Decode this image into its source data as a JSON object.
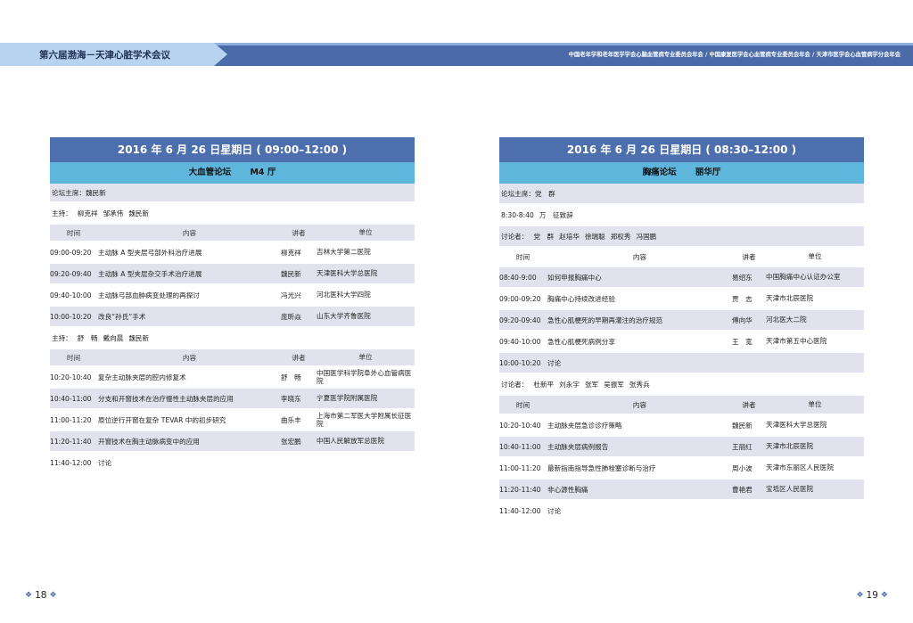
{
  "header": {
    "left_title": "第六届渤海－天津心脏学术会议",
    "right_title": "中国老年学和老年医学学会心脑血管病专业委员会年会 / 中国康复医学会心血管病专业委员会年会 / 天津市医学会心血管病学分会年会"
  },
  "columns": {
    "time": "时间",
    "content": "内容",
    "speaker": "讲者",
    "unit": "单位"
  },
  "left": {
    "date": "2016 年 6 月 26 日星期日 ( 09:00–12:00 )",
    "forum_name": "大血管论坛",
    "forum_room": "M4 厅",
    "chair": "论坛主席：魏民新",
    "host1_label": "主持：",
    "host1_names": [
      "柳克祥",
      "邹承伟",
      "魏民新"
    ],
    "rows1": [
      {
        "time": "09:00-09:20",
        "content": "主动脉 A 型夹层弓部外科治疗进展",
        "speaker": "柳克祥",
        "unit": "吉林大学第二医院"
      },
      {
        "time": "09:20-09:40",
        "content": "主动脉 A 型夹层杂交手术治疗进展",
        "speaker": "魏民新",
        "unit": "天津医科大学总医院"
      },
      {
        "time": "09:40-10:00",
        "content": "主动脉弓部血肿病变处理的再探讨",
        "speaker": "冯光兴",
        "unit": "河北医科大学四院"
      },
      {
        "time": "10:00-10:20",
        "content": "改良“孙氏”手术",
        "speaker": "庞昕焱",
        "unit": "山东大学齐鲁医院"
      }
    ],
    "host2_label": "主持：",
    "host2_names": [
      "舒　畅",
      "戴向晨",
      "魏民新"
    ],
    "rows2": [
      {
        "time": "10:20-10:40",
        "content": "复杂主动脉夹层的腔内修复术",
        "speaker": "舒　畅",
        "unit": "中国医学科学院阜外心血管病医院"
      },
      {
        "time": "10:40-11:00",
        "content": "分支和开窗技术在治疗慢性主动脉夹层的应用",
        "speaker": "李晓东",
        "unit": "宁夏医学院附属医院"
      },
      {
        "time": "11:00-11:20",
        "content": "原位逆行开窗在复杂 TEVAR 中的初步研究",
        "speaker": "曲乐丰",
        "unit": "上海市第二军医大学附属长征医院"
      },
      {
        "time": "11:20-11:40",
        "content": "开窗技术在胸主动脉病变中的应用",
        "speaker": "张宏鹏",
        "unit": "中国人民解放军总医院"
      }
    ],
    "end_time": "11:40-12:00",
    "end_label": "讨论"
  },
  "right": {
    "date": "2016 年 6 月 26 日星期日 ( 08:30–12:00 )",
    "forum_name": "胸痛论坛",
    "forum_room": "丽华厅",
    "chair": "论坛主席：党　群",
    "opening_time": "8:30-8:40",
    "opening_names": [
      "万　征致辞"
    ],
    "disc1_label": "讨论者：",
    "disc1_names": [
      "党　群",
      "赵培华",
      "徐瑞聪",
      "郑权秀",
      "冯国鹏"
    ],
    "rows1": [
      {
        "time": "08:40-9:00",
        "content": "如何申报胸痛中心",
        "speaker": "易绍东",
        "unit": "中国胸痛中心认证办公室"
      },
      {
        "time": "09:00-09:20",
        "content": "胸痛中心持续改进经验",
        "speaker": "贾　志",
        "unit": "天津市北辰医院"
      },
      {
        "time": "09:20-09:40",
        "content": "急性心肌梗死的早期再灌注的治疗规范",
        "speaker": "傅向华",
        "unit": "河北医大二院"
      },
      {
        "time": "09:40-10:00",
        "content": "急性心肌梗死病例分享",
        "speaker": "王　宽",
        "unit": "天津市第五中心医院"
      }
    ],
    "mid_time": "10:00-10:20",
    "mid_label": "讨论",
    "disc2_label": "讨论者：",
    "disc2_names": [
      "杜新平",
      "刘永宇",
      "张军",
      "吴振军",
      "张秀兵"
    ],
    "rows2": [
      {
        "time": "10:20-10:40",
        "content": "主动脉夹层急诊诊疗策略",
        "speaker": "魏民新",
        "unit": "天津医科大学总医院"
      },
      {
        "time": "10:40-11:00",
        "content": "主动脉夹层病例报告",
        "speaker": "王丽红",
        "unit": "天津市北辰医院"
      },
      {
        "time": "11:00-11:20",
        "content": "最新指南指导急性肺栓塞诊断与治疗",
        "speaker": "周小波",
        "unit": "天津市东丽区人民医院"
      },
      {
        "time": "11:20-11:40",
        "content": "非心源性胸痛",
        "speaker": "曹艳君",
        "unit": "宝坻区人民医院"
      }
    ],
    "end_time": "11:40-12:00",
    "end_label": "讨论"
  },
  "pages": {
    "left": "18",
    "right": "19",
    "ornament": "❖"
  }
}
